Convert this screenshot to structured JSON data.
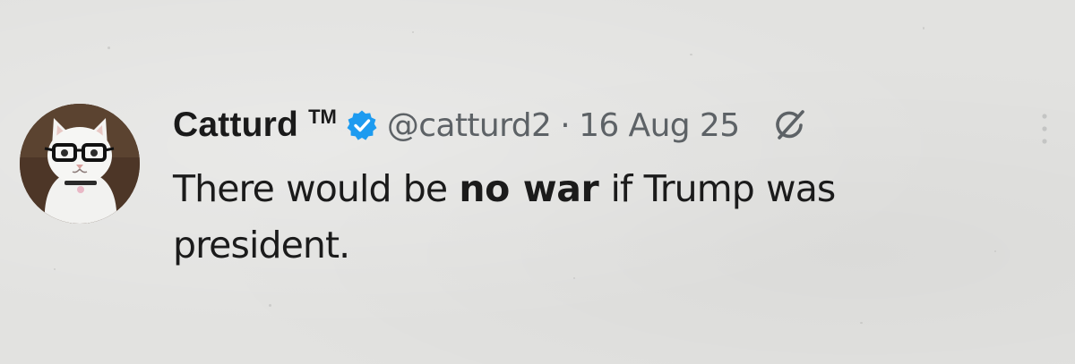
{
  "tweet": {
    "author": {
      "display_name": "Catturd",
      "tm": "TM",
      "handle": "@catturd2",
      "verified": true,
      "avatar": "cat-with-glasses-avatar"
    },
    "separator": "·",
    "date": "16 Aug 25",
    "text": {
      "before": "There would be ",
      "bold": "no war",
      "after": " if Trump was president."
    },
    "icons": {
      "verified": "verified-badge-icon",
      "grok": "grok-icon",
      "more": "more-options-icon"
    }
  },
  "colors": {
    "background": "#e2e2e0",
    "text": "#1b1b1b",
    "secondary_text": "#5d6266",
    "verified_blue": "#1d9bf0"
  }
}
